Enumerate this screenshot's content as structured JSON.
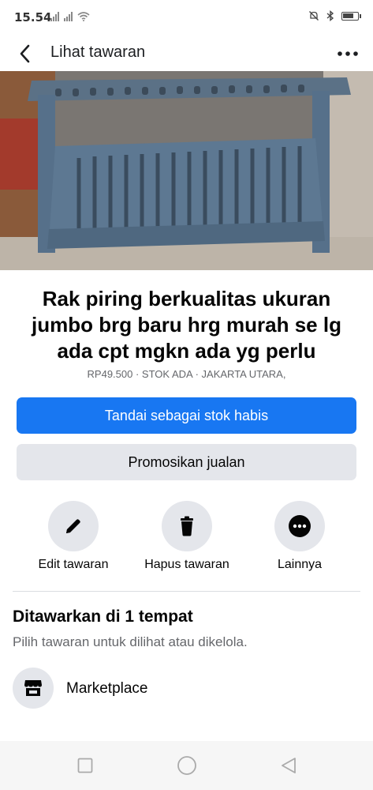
{
  "status_bar": {
    "time": "15.54",
    "battery_level": 0.8
  },
  "header": {
    "title": "Lihat tawaran"
  },
  "photo": {
    "slide_count": 7,
    "active_slide": 0
  },
  "listing": {
    "title": "Rak piring berkualitas ukuran jumbo brg baru  hrg murah se lg ada cpt mgkn ada yg perlu",
    "meta": "RP49.500 · STOK ADA · JAKARTA UTARA,"
  },
  "buttons": {
    "mark_sold": "Tandai sebagai stok habis",
    "promote": "Promosikan jualan"
  },
  "actions": [
    {
      "label": "Edit tawaran",
      "icon": "pencil-icon"
    },
    {
      "label": "Hapus tawaran",
      "icon": "trash-icon"
    },
    {
      "label": "Lainnya",
      "icon": "more-circle-icon"
    }
  ],
  "offered": {
    "title": "Ditawarkan di 1 tempat",
    "subtitle": "Pilih tawaran untuk dilihat atau dikelola.",
    "places": [
      {
        "label": "Marketplace",
        "icon": "storefront-icon"
      }
    ]
  },
  "colors": {
    "primary": "#1877f2",
    "secondary_bg": "#e4e6eb",
    "muted_text": "#65676b"
  }
}
